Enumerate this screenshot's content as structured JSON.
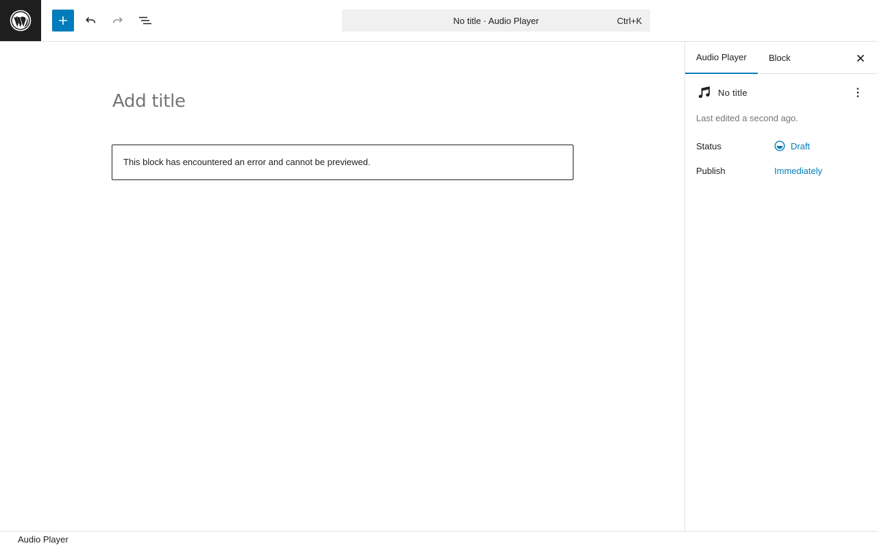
{
  "header": {
    "logo_icon": "wordpress-logo-icon",
    "inserter_icon": "plus-icon",
    "undo_icon": "undo-icon",
    "redo_icon": "redo-icon",
    "list_view_icon": "list-view-icon",
    "command_bar": {
      "label": "No title · Audio Player",
      "shortcut": "Ctrl+K"
    }
  },
  "editor": {
    "title_placeholder": "Add title",
    "error_message": "This block has encountered an error and cannot be previewed."
  },
  "sidebar": {
    "tabs": [
      {
        "label": "Audio Player",
        "active": true
      },
      {
        "label": "Block",
        "active": false
      }
    ],
    "close_icon": "close-icon",
    "document": {
      "icon": "music-note-icon",
      "title": "No title",
      "more_icon": "more-vertical-icon",
      "last_edited": "Last edited a second ago."
    },
    "status": {
      "label": "Status",
      "value": "Draft",
      "icon": "draft-status-icon"
    },
    "publish": {
      "label": "Publish",
      "value": "Immediately"
    }
  },
  "footer": {
    "breadcrumb": "Audio Player"
  },
  "colors": {
    "accent": "#007cba",
    "dark": "#1e1e1e",
    "muted": "#757575",
    "border": "#e0e0e0",
    "command_bar_bg": "#f0f0f0"
  }
}
